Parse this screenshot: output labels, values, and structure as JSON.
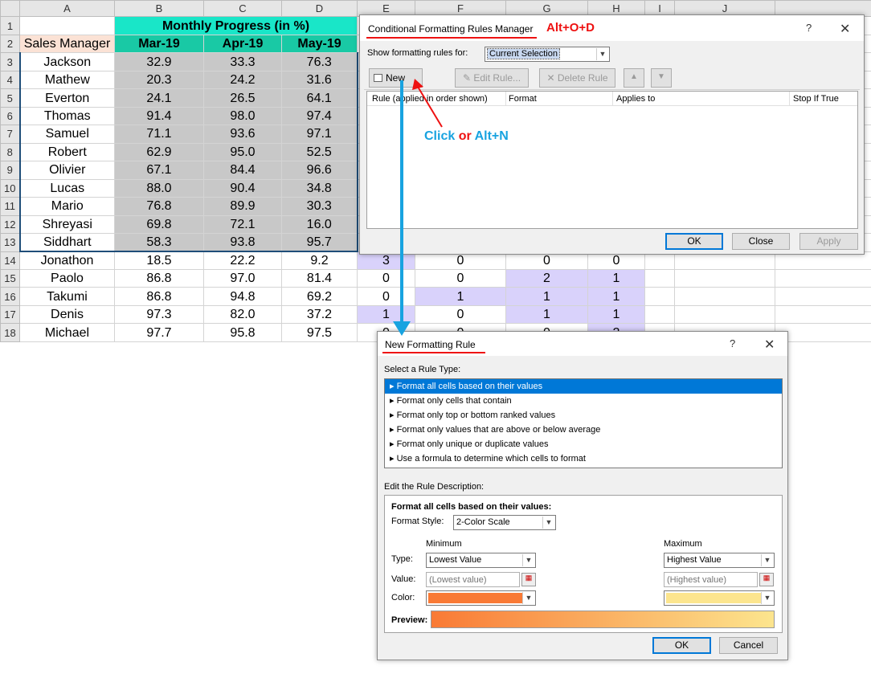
{
  "sheet": {
    "columns": [
      "A",
      "B",
      "C",
      "D",
      "E",
      "F",
      "G",
      "H",
      "I",
      "J"
    ],
    "title": "Monthly Progress (in %)",
    "sales_manager_header": "Sales Manager",
    "month_headers": [
      "Mar-19",
      "Apr-19",
      "May-19"
    ],
    "rows": [
      {
        "n": "3",
        "name": "Jackson",
        "v": [
          "32.9",
          "33.3",
          "76.3"
        ]
      },
      {
        "n": "4",
        "name": "Mathew",
        "v": [
          "20.3",
          "24.2",
          "31.6"
        ]
      },
      {
        "n": "5",
        "name": "Everton",
        "v": [
          "24.1",
          "26.5",
          "64.1"
        ]
      },
      {
        "n": "6",
        "name": "Thomas",
        "v": [
          "91.4",
          "98.0",
          "97.4"
        ]
      },
      {
        "n": "7",
        "name": "Samuel",
        "v": [
          "71.1",
          "93.6",
          "97.1"
        ]
      },
      {
        "n": "8",
        "name": "Robert",
        "v": [
          "62.9",
          "95.0",
          "52.5"
        ]
      },
      {
        "n": "9",
        "name": "Olivier",
        "v": [
          "67.1",
          "84.4",
          "96.6"
        ]
      },
      {
        "n": "10",
        "name": "Lucas",
        "v": [
          "88.0",
          "90.4",
          "34.8"
        ]
      },
      {
        "n": "11",
        "name": "Mario",
        "v": [
          "76.8",
          "89.9",
          "30.3"
        ]
      },
      {
        "n": "12",
        "name": "Shreyasi",
        "v": [
          "69.8",
          "72.1",
          "16.0"
        ]
      },
      {
        "n": "13",
        "name": "Siddhart",
        "v": [
          "58.3",
          "93.8",
          "95.7"
        ]
      },
      {
        "n": "14",
        "name": "Jonathon",
        "v": [
          "18.5",
          "22.2",
          "9.2"
        ],
        "e": [
          "3",
          "0",
          "0",
          "0"
        ]
      },
      {
        "n": "15",
        "name": "Paolo",
        "v": [
          "86.8",
          "97.0",
          "81.4"
        ],
        "e": [
          "0",
          "0",
          "2",
          "1"
        ]
      },
      {
        "n": "16",
        "name": "Takumi",
        "v": [
          "86.8",
          "94.8",
          "69.2"
        ],
        "e": [
          "0",
          "1",
          "1",
          "1"
        ]
      },
      {
        "n": "17",
        "name": "Denis",
        "v": [
          "97.3",
          "82.0",
          "37.2"
        ],
        "e": [
          "1",
          "0",
          "1",
          "1"
        ]
      },
      {
        "n": "18",
        "name": "Michael",
        "v": [
          "97.7",
          "95.8",
          "97.5"
        ],
        "e": [
          "0",
          "0",
          "0",
          "2"
        ]
      }
    ]
  },
  "rules_manager": {
    "title": "Conditional Formatting Rules Manager",
    "shortcut": "Alt+O+D",
    "help": "?",
    "close": "✕",
    "show_rules_label": "Show formatting rules for:",
    "show_rules_value": "Current Selection",
    "new_rule": "New Rule...",
    "edit_rule": "Edit Rule...",
    "delete_rule": "Delete Rule",
    "columns": [
      "Rule (applied in order shown)",
      "Format",
      "Applies to",
      "Stop If True"
    ],
    "annotation_click": "Click",
    "annotation_or": "or",
    "annotation_alt": "Alt+N",
    "ok": "OK",
    "close_btn": "Close",
    "apply": "Apply"
  },
  "new_rule": {
    "title": "New Formatting Rule",
    "help": "?",
    "close": "✕",
    "select_type_label": "Select a Rule Type:",
    "rule_types": [
      "Format all cells based on their values",
      "Format only cells that contain",
      "Format only top or bottom ranked values",
      "Format only values that are above or below average",
      "Format only unique or duplicate values",
      "Use a formula to determine which cells to format"
    ],
    "edit_desc_label": "Edit the Rule Description:",
    "desc_heading": "Format all cells based on their values:",
    "format_style_label": "Format Style:",
    "format_style_value": "2-Color Scale",
    "minimum_label": "Minimum",
    "maximum_label": "Maximum",
    "type_label": "Type:",
    "value_label": "Value:",
    "color_label": "Color:",
    "min_type": "Lowest Value",
    "max_type": "Highest Value",
    "min_value_placeholder": "(Lowest value)",
    "max_value_placeholder": "(Highest value)",
    "min_color": "#f97a35",
    "max_color": "#fce58e",
    "preview_label": "Preview:",
    "ok": "OK",
    "cancel": "Cancel"
  },
  "colors": {
    "accent": "#0078d7",
    "annotation_red": "#e11111",
    "annotation_blue": "#18a3e0"
  }
}
